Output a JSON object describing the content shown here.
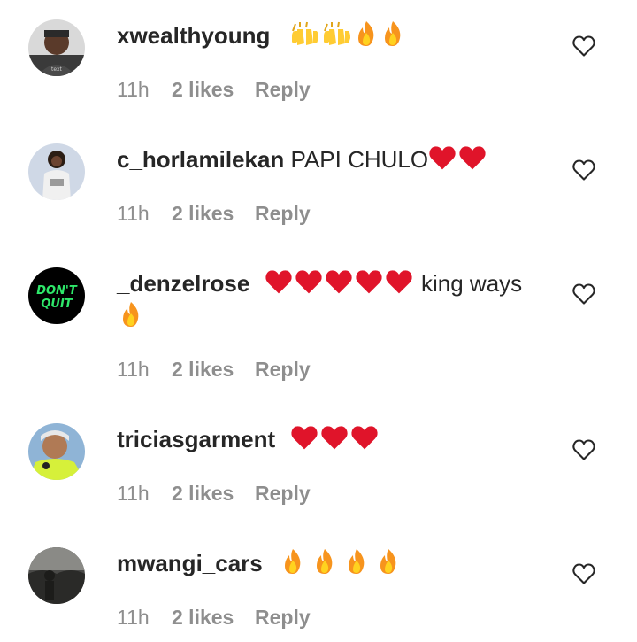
{
  "comments": [
    {
      "username": "xwealthyoung",
      "text": "",
      "emojis": [
        "raising-hands-emoji",
        "raising-hands-emoji",
        "fire-emoji",
        "fire-emoji"
      ],
      "time": "11h",
      "likes": "2 likes",
      "reply": "Reply"
    },
    {
      "username": "c_horlamilekan",
      "text": "PAPI CHULO",
      "emojis": [
        "red-heart-emoji",
        "red-heart-emoji"
      ],
      "time": "11h",
      "likes": "2 likes",
      "reply": "Reply"
    },
    {
      "username": "_denzelrose",
      "text": "king ways",
      "emojis": [
        "red-heart-emoji",
        "red-heart-emoji",
        "red-heart-emoji",
        "red-heart-emoji",
        "red-heart-emoji",
        "fire-emoji"
      ],
      "avatar_text": [
        "DON'T",
        "QUIT"
      ],
      "time": "11h",
      "likes": "2 likes",
      "reply": "Reply"
    },
    {
      "username": "triciasgarment",
      "text": "",
      "emojis": [
        "red-heart-emoji",
        "red-heart-emoji",
        "red-heart-emoji"
      ],
      "time": "11h",
      "likes": "2 likes",
      "reply": "Reply"
    },
    {
      "username": "mwangi_cars",
      "text": "",
      "emojis": [
        "fire-emoji",
        "fire-emoji",
        "fire-emoji",
        "fire-emoji"
      ],
      "time": "11h",
      "likes": "2 likes",
      "reply": "Reply"
    }
  ],
  "colors": {
    "username": "#262626",
    "meta": "#8e8e8e",
    "heart_emoji": "#e0142a",
    "fire_outer": "#f7941d",
    "fire_inner": "#ffd21f",
    "like_outline": "#262626"
  }
}
